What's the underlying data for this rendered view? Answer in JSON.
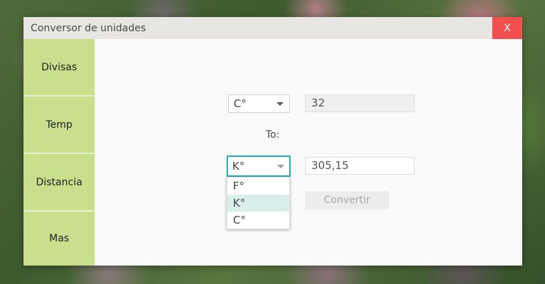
{
  "window": {
    "title": "Conversor de unidades",
    "close_label": "X"
  },
  "sidebar": {
    "items": [
      {
        "label": "Divisas"
      },
      {
        "label": "Temp"
      },
      {
        "label": "Distancia"
      },
      {
        "label": "Mas"
      }
    ]
  },
  "converter": {
    "from_unit": "C°",
    "from_value": "32",
    "to_label": "To:",
    "to_unit": "K°",
    "to_value": "305,15",
    "convert_label": "Convertir",
    "unit_options": [
      {
        "label": "F°",
        "selected": false
      },
      {
        "label": "K°",
        "selected": true
      },
      {
        "label": "C°",
        "selected": false
      }
    ]
  },
  "colors": {
    "sidebar_bg": "#c8e08e",
    "close_bg": "#f44f4f",
    "focus_border": "#1fb0c4"
  }
}
